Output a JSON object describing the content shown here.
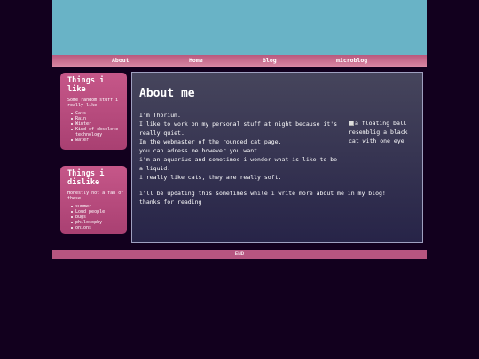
{
  "nav": {
    "items": [
      "About",
      "Home",
      "Blog",
      "microblog"
    ]
  },
  "sidebar": {
    "likes": {
      "title": "Things i like",
      "intro": "Some random stuff i really like",
      "items": [
        "Cats",
        "Rain",
        "Winter",
        "Kind-of-obsolete technology",
        "water"
      ]
    },
    "dislikes": {
      "title": "Things i dislike",
      "intro": "Honestly not a fan of these",
      "items": [
        "summer",
        "Loud people",
        "bugs",
        "philosophy",
        "onions"
      ]
    }
  },
  "main": {
    "title": "About me",
    "lines": [
      "I'm Thorium.",
      "I like to work on my personal stuff at night because it's really quiet.",
      "Im the webmaster of the rounded cat page.",
      "you can adress me however you want.",
      "i'm an aquarius and sometimes i wonder what is like to be a liquid.",
      "i really like cats, they are really soft."
    ],
    "image_alt": "a floating ball resemblig a black cat with one eye",
    "outro": [
      "i'll be updating this sometimes while i write more about me in my blog!",
      "thanks for reading"
    ]
  },
  "footer": {
    "text": "END"
  },
  "colors": {
    "background": "#12001e",
    "banner": "#69b3c6",
    "accent_pink": "#c65789",
    "footer": "#b65580"
  }
}
